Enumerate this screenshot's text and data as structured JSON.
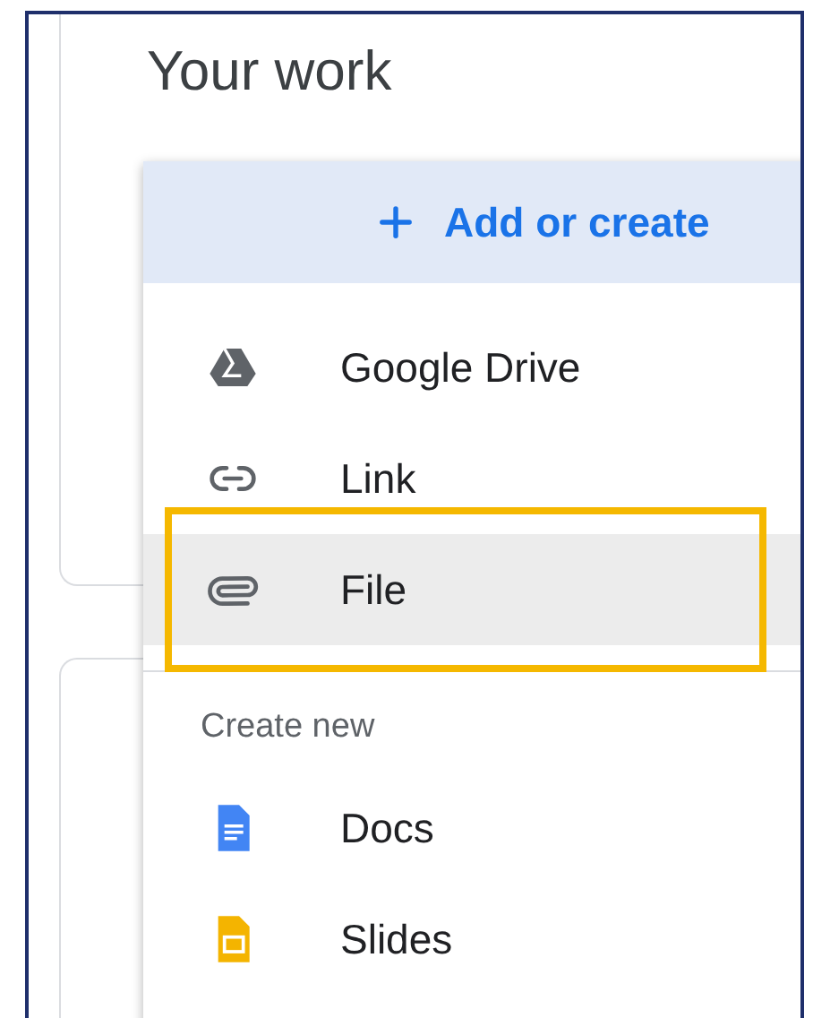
{
  "card": {
    "title": "Your work"
  },
  "menu": {
    "header": {
      "label": "Add or create"
    },
    "items": [
      {
        "label": "Google Drive",
        "kind": "drive",
        "selected": false
      },
      {
        "label": "Link",
        "kind": "link",
        "selected": false
      },
      {
        "label": "File",
        "kind": "file",
        "selected": true
      }
    ],
    "section": {
      "heading": "Create new",
      "items": [
        {
          "label": "Docs",
          "kind": "docs"
        },
        {
          "label": "Slides",
          "kind": "slides"
        }
      ]
    }
  }
}
